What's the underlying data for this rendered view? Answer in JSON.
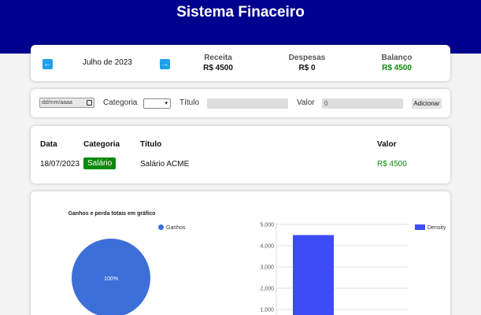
{
  "header": {
    "title": "Sistema Finaceiro"
  },
  "month_nav": {
    "prev_icon": "arrow-left-icon",
    "next_icon": "arrow-right-icon",
    "month_label": "Julho de 2023"
  },
  "summary": {
    "receita_label": "Receita",
    "receita_value": "R$ 4500",
    "despesas_label": "Despesas",
    "despesas_value": "R$ 0",
    "balanco_label": "Balanço",
    "balanco_value": "R$ 4500",
    "balance_color": "#0a8a0a"
  },
  "form": {
    "date_placeholder": "dd/mm/aaaa",
    "category_label": "Categoria",
    "category_selected": "",
    "title_label": "Título",
    "title_value": "",
    "value_label": "Valor",
    "value_value": "0",
    "add_button": "Adicionar"
  },
  "table": {
    "headers": [
      "Data",
      "Categoria",
      "Título",
      "Valor"
    ],
    "rows": [
      {
        "date": "18/07/2023",
        "category": "Salário",
        "title": "Salário ACME",
        "value": "R$ 4500"
      }
    ],
    "category_badge_color": "#0a8a0a"
  },
  "chart_data": [
    {
      "type": "pie",
      "title": "Ganhos e perda totais em gráfico",
      "categories": [
        "Ganhos"
      ],
      "values": [
        100
      ],
      "data_labels": [
        "100%"
      ],
      "colors": [
        "#3d6fd8"
      ],
      "legend": "top-right"
    },
    {
      "type": "bar",
      "categories": [
        ""
      ],
      "series": [
        {
          "name": "Density",
          "values": [
            4500
          ]
        }
      ],
      "y_tick_labels": [
        "1,000",
        "2,000",
        "3,000",
        "4,000",
        "5,000"
      ],
      "ylim": [
        0,
        5000
      ],
      "colors": [
        "#3e4cf6"
      ],
      "grid": true,
      "legend": "top-right"
    }
  ]
}
